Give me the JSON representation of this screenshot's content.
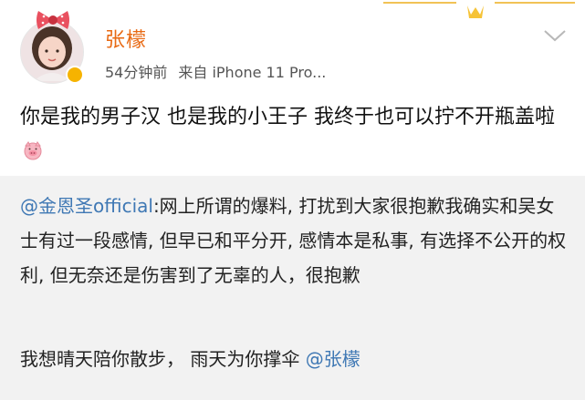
{
  "post": {
    "username": "张檬",
    "time": "54分钟前",
    "source": "来自 iPhone 11 Pro...",
    "content": "你是我的男子汉  也是我的小王子  我终于也可以拧不开瓶盖啦",
    "emoji": "pig-face-emoji"
  },
  "repost": {
    "mention": "@金恩圣official",
    "text": ":网上所谓的爆料, 打扰到大家很抱歉我确实和吴女士有过一段感情, 但早已和平分开, 感情本是私事, 有选择不公开的权利, 但无奈还是伤害到了无辜的人，很抱歉",
    "second_text": "我想晴天陪你散步，  雨天为你撑伞 ",
    "second_mention": "@张檬"
  },
  "icons": {
    "chevron": "chevron-down-icon",
    "verified": "verified-badge-icon",
    "bow": "bow-decoration"
  },
  "colors": {
    "username": "#e86a14",
    "mention": "#3f78b4",
    "repost_background": "#f2f2f2",
    "badge": "#f6b300"
  }
}
